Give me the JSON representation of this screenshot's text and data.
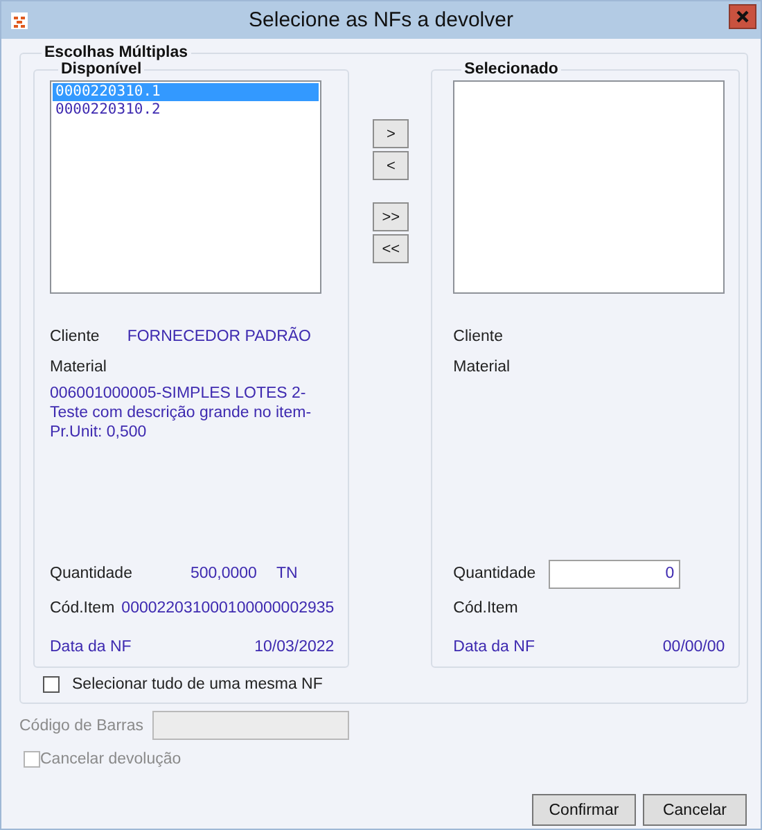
{
  "window": {
    "title": "Selecione as NFs a devolver"
  },
  "group": {
    "title": "Escolhas Múltiplas"
  },
  "available": {
    "title": "Disponível",
    "items": [
      {
        "label": "0000220310.1",
        "selected": true
      },
      {
        "label": "0000220310.2",
        "selected": false
      }
    ],
    "cliente_label": "Cliente",
    "cliente": "FORNECEDOR PADRÃO",
    "material_label": "Material",
    "material": "006001000005-SIMPLES LOTES 2-Teste com descrição grande no item- Pr.Unit: 0,500",
    "quantidade_label": "Quantidade",
    "quantidade": "500,0000",
    "unit": "TN",
    "cod_item_label": "Cód.Item",
    "cod_item": "000022031000100000002935",
    "data_label": "Data da NF",
    "data": "10/03/2022"
  },
  "transfer_buttons": [
    ">",
    "<",
    ">>",
    "<<"
  ],
  "selected": {
    "title": "Selecionado",
    "cliente_label": "Cliente",
    "material_label": "Material",
    "quantidade_label": "Quantidade",
    "quantidade": "0",
    "cod_item_label": "Cód.Item",
    "data_label": "Data da NF",
    "data": "00/00/00"
  },
  "select_all": {
    "label": "Selecionar tudo de uma mesma NF",
    "checked": false
  },
  "barcode": {
    "label": "Código de Barras",
    "disabled": true
  },
  "cancel_return": {
    "label": "Cancelar devolução",
    "checked": false,
    "disabled": true
  },
  "buttons": [
    "Confirmar",
    "Cancelar"
  ]
}
